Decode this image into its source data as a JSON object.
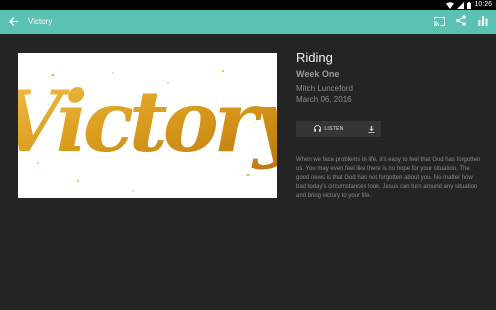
{
  "status_bar": {
    "time": "10:26"
  },
  "app_bar": {
    "title": "Victory",
    "accent_color": "#5bc2b3"
  },
  "artwork": {
    "text": "Victory",
    "color": "#d9a21f"
  },
  "message": {
    "title": "Riding",
    "series": "Week One",
    "speaker": "Mitch Lunceford",
    "date": "March 06, 2016"
  },
  "player": {
    "listen_label": "LISTEN"
  },
  "description": "When we face problems in life, it's easy to feel that God has forgotten us. You may even feel like there is no hope for your situation. The good news is that God has not forgotten about you. No matter how bad today's circumstances look, Jesus can turn around any situation and bring victory to your life."
}
